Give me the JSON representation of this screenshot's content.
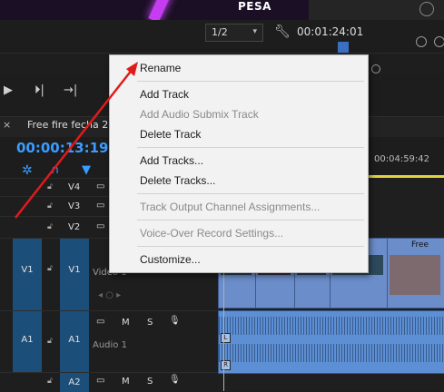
{
  "program_monitor": {
    "preview_logo": "PESA",
    "resolution": "1/2",
    "timecode": "00:01:24:01"
  },
  "timeline": {
    "tab_close": "×",
    "sequence_tab": "Free fire fecha 2",
    "tab_menu": "≡",
    "current_timecode": "00:00:13:19",
    "ruler_timecode": "00:04:59:42",
    "clip_label_free": "Free",
    "tracks": {
      "v4": "V4",
      "v3": "V3",
      "v2": "V2",
      "v1_source": "V1",
      "v1_target": "V1",
      "v1_name": "Video 1",
      "a1_source": "A1",
      "a1_target": "A1",
      "a1_name": "Audio 1",
      "a2_target": "A2",
      "mute": "M",
      "solo": "S"
    },
    "audio_channel_l": "L",
    "audio_channel_r": "R"
  },
  "context_menu": {
    "rename": "Rename",
    "add_track": "Add Track",
    "add_audio_submix_track": "Add Audio Submix Track",
    "delete_track": "Delete Track",
    "add_tracks": "Add Tracks...",
    "delete_tracks": "Delete Tracks...",
    "track_output_channel": "Track Output Channel Assignments...",
    "voice_over_settings": "Voice-Over Record Settings...",
    "customize": "Customize..."
  },
  "colors": {
    "accent_blue": "#3b9cff",
    "track_target_blue": "#1b4f7a",
    "annotation_arrow": "#e01b1b",
    "menu_background": "#f2f2f2"
  }
}
